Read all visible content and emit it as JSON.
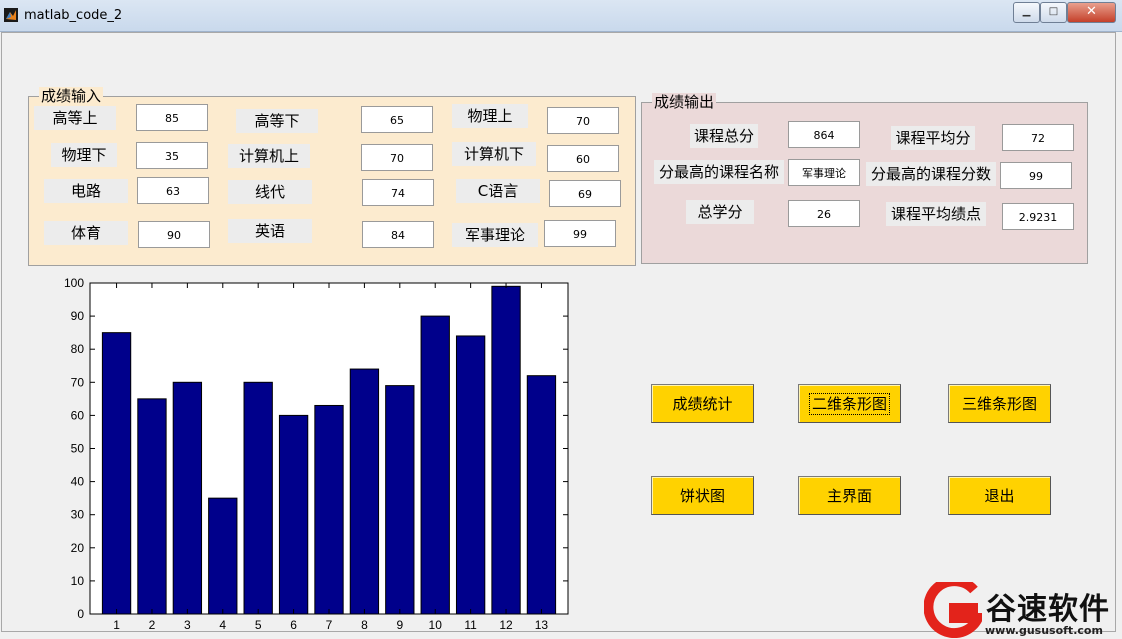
{
  "window": {
    "title": "matlab_code_2"
  },
  "input_panel": {
    "title": "成绩输入",
    "fields": [
      {
        "label": "高等上",
        "value": "85"
      },
      {
        "label": "高等下",
        "value": "65"
      },
      {
        "label": "物理上",
        "value": "70"
      },
      {
        "label": "物理下",
        "value": "35"
      },
      {
        "label": "计算机上",
        "value": "70"
      },
      {
        "label": "计算机下",
        "value": "60"
      },
      {
        "label": "电路",
        "value": "63"
      },
      {
        "label": "线代",
        "value": "74"
      },
      {
        "label": "C语言",
        "value": "69"
      },
      {
        "label": "体育",
        "value": "90"
      },
      {
        "label": "英语",
        "value": "84"
      },
      {
        "label": "军事理论",
        "value": "99"
      }
    ]
  },
  "output_panel": {
    "title": "成绩输出",
    "fields": [
      {
        "label": "课程总分",
        "value": "864"
      },
      {
        "label": "课程平均分",
        "value": "72"
      },
      {
        "label": "分最高的课程名称",
        "value": "军事理论"
      },
      {
        "label": "分最高的课程分数",
        "value": "99"
      },
      {
        "label": "总学分",
        "value": "26"
      },
      {
        "label": "课程平均绩点",
        "value": "2.9231"
      }
    ]
  },
  "buttons": {
    "stats": "成绩统计",
    "bar2d": "二维条形图",
    "bar3d": "三维条形图",
    "pie": "饼状图",
    "main": "主界面",
    "exit": "退出"
  },
  "watermark": {
    "text": "谷速软件",
    "url": "www.gususoft.com"
  },
  "colors": {
    "bar": "#00008b",
    "button": "#ffd200",
    "input_panel_bg": "#fcebcf",
    "output_panel_bg": "#ebd9d9"
  },
  "chart_data": {
    "type": "bar",
    "categories": [
      "1",
      "2",
      "3",
      "4",
      "5",
      "6",
      "7",
      "8",
      "9",
      "10",
      "11",
      "12",
      "13"
    ],
    "values": [
      85,
      65,
      70,
      35,
      70,
      60,
      63,
      74,
      69,
      90,
      84,
      99,
      72
    ],
    "yticks": [
      0,
      10,
      20,
      30,
      40,
      50,
      60,
      70,
      80,
      90,
      100
    ],
    "ylim": [
      0,
      100
    ],
    "title": "",
    "xlabel": "",
    "ylabel": ""
  }
}
